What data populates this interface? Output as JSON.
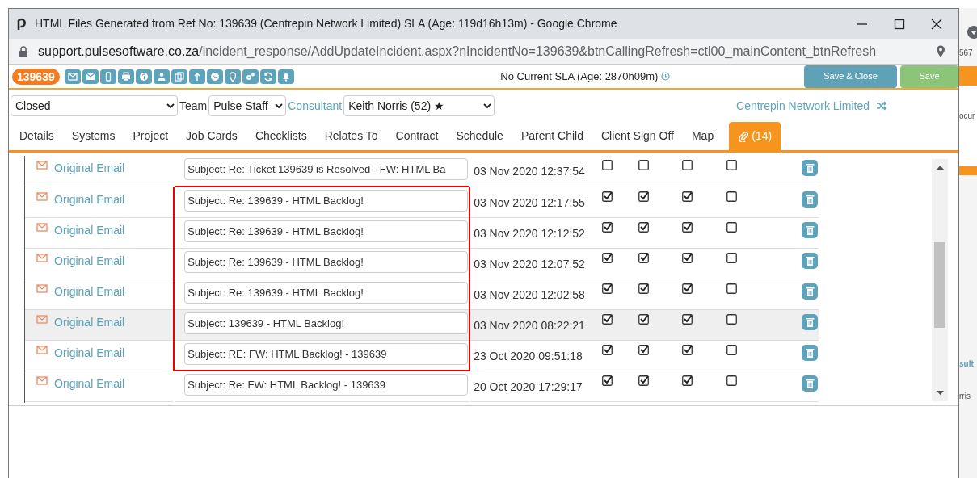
{
  "window": {
    "title": "HTML Files Generated from Ref No: 139639 (Centrepin Network Limited) SLA (Age: 119d16h13m) - Google Chrome"
  },
  "address_bar": {
    "host": "support.pulsesoftware.co.za",
    "path": "/incident_response/AddUpdateIncident.aspx?nIncidentNo=139639&btnCallingRefresh=ctl00_mainContent_btnRefresh"
  },
  "toolbar": {
    "ref_badge": "139639",
    "sla": "No Current SLA (Age: 2870h09m)",
    "buttons": [
      {
        "label": "Save & Close",
        "kind": "primary"
      },
      {
        "label": "Save",
        "kind": "success"
      }
    ]
  },
  "filters": {
    "status": "Closed",
    "team_label": "Team",
    "team": "Pulse Staff",
    "consultant_label": "Consultant",
    "consultant": "Keith Norris (52) ★",
    "client": "Centrepin Network Limited"
  },
  "tabs": [
    {
      "label": "Details",
      "selected": false
    },
    {
      "label": "Systems",
      "selected": false
    },
    {
      "label": "Project",
      "selected": false
    },
    {
      "label": "Job Cards",
      "selected": false
    },
    {
      "label": "Checklists",
      "selected": false
    },
    {
      "label": "Relates To",
      "selected": false
    },
    {
      "label": "Contract",
      "selected": false
    },
    {
      "label": "Schedule",
      "selected": false
    },
    {
      "label": "Parent Child",
      "selected": false
    },
    {
      "label": "Client Sign Off",
      "selected": false
    },
    {
      "label": "Map",
      "selected": false
    },
    {
      "label": "(14)",
      "selected": true,
      "kind": "attachments"
    }
  ],
  "rows": [
    {
      "link": "Original Email",
      "subject": "Subject: Re: Ticket 139639 is Resolved - FW: HTML Ba",
      "date": "03 Nov 2020 12:37:54",
      "checks": [
        false,
        false,
        false,
        false
      ],
      "hovered": false,
      "boxed": false
    },
    {
      "link": "Original Email",
      "subject": "Subject: Re: 139639 - HTML Backlog!",
      "date": "03 Nov 2020 12:17:55",
      "checks": [
        true,
        true,
        true,
        false
      ],
      "hovered": false,
      "boxed": true
    },
    {
      "link": "Original Email",
      "subject": "Subject: Re: 139639 - HTML Backlog!",
      "date": "03 Nov 2020 12:12:52",
      "checks": [
        true,
        true,
        true,
        false
      ],
      "hovered": false,
      "boxed": true
    },
    {
      "link": "Original Email",
      "subject": "Subject: Re: 139639 - HTML Backlog!",
      "date": "03 Nov 2020 12:07:52",
      "checks": [
        true,
        true,
        true,
        false
      ],
      "hovered": false,
      "boxed": true
    },
    {
      "link": "Original Email",
      "subject": "Subject: Re: 139639 - HTML Backlog!",
      "date": "03 Nov 2020 12:02:58",
      "checks": [
        true,
        true,
        true,
        false
      ],
      "hovered": false,
      "boxed": true
    },
    {
      "link": "Original Email",
      "subject": "Subject: 139639 - HTML Backlog!",
      "date": "03 Nov 2020 08:22:21",
      "checks": [
        true,
        true,
        true,
        false
      ],
      "hovered": true,
      "boxed": true
    },
    {
      "link": "Original Email",
      "subject": "Subject: RE: FW: HTML Backlog! - 139639",
      "date": "23 Oct 2020 09:51:18",
      "checks": [
        true,
        true,
        true,
        false
      ],
      "hovered": false,
      "boxed": true
    },
    {
      "link": "Original Email",
      "subject": "Subject: Re: FW: HTML Backlog! - 139639",
      "date": "20 Oct 2020 17:29:17",
      "checks": [
        true,
        true,
        true,
        false
      ],
      "hovered": false,
      "boxed": false
    }
  ],
  "background_window": {
    "fragments": [
      "567",
      "ocur",
      "sult",
      "rris"
    ]
  }
}
